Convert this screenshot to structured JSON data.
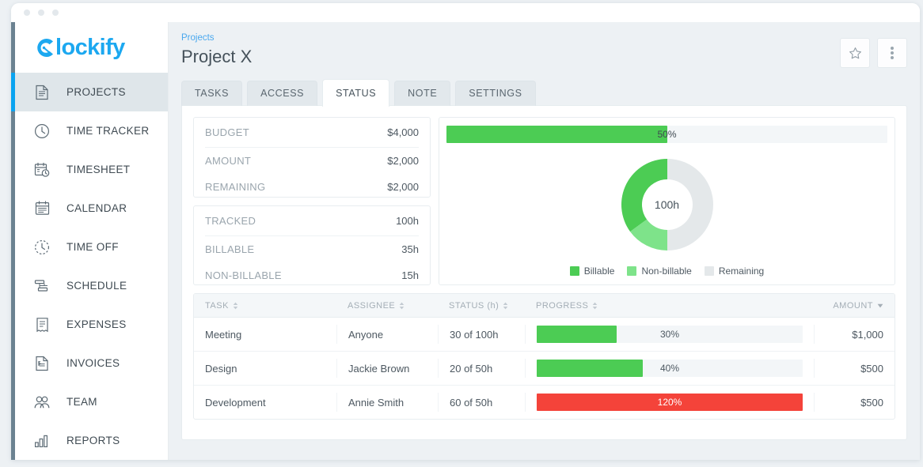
{
  "window": {
    "dots": [
      "dot-1",
      "dot-2",
      "dot-3"
    ]
  },
  "sidebar": {
    "logo": "lockify",
    "logo_full": "Clockify",
    "items": [
      {
        "label": "PROJECTS",
        "icon": "document-icon",
        "active": true
      },
      {
        "label": "TIME TRACKER",
        "icon": "clock-icon",
        "active": false
      },
      {
        "label": "TIMESHEET",
        "icon": "calendar-clock-icon",
        "active": false
      },
      {
        "label": "CALENDAR",
        "icon": "calendar-icon",
        "active": false
      },
      {
        "label": "TIME OFF",
        "icon": "clock-dashed-icon",
        "active": false
      },
      {
        "label": "SCHEDULE",
        "icon": "gantt-icon",
        "active": false
      },
      {
        "label": "EXPENSES",
        "icon": "receipt-icon",
        "active": false
      },
      {
        "label": "INVOICES",
        "icon": "invoice-icon",
        "active": false
      },
      {
        "label": "TEAM",
        "icon": "people-icon",
        "active": false
      },
      {
        "label": "REPORTS",
        "icon": "bar-chart-icon",
        "active": false
      }
    ]
  },
  "header": {
    "breadcrumb": "Projects",
    "title": "Project X",
    "favorite_icon": "star-icon",
    "more_icon": "more-vertical-icon"
  },
  "tabs": [
    {
      "label": "TASKS",
      "active": false
    },
    {
      "label": "ACCESS",
      "active": false
    },
    {
      "label": "STATUS",
      "active": true
    },
    {
      "label": "NOTE",
      "active": false
    },
    {
      "label": "SETTINGS",
      "active": false
    }
  ],
  "budget_box": {
    "primary": {
      "label": "BUDGET",
      "value": "$4,000"
    },
    "rows": [
      {
        "label": "AMOUNT",
        "value": "$2,000"
      },
      {
        "label": "REMAINING",
        "value": "$2,000"
      }
    ]
  },
  "time_box": {
    "primary": {
      "label": "TRACKED",
      "value": "100h"
    },
    "rows": [
      {
        "label": "BILLABLE",
        "value": "35h"
      },
      {
        "label": "NON-BILLABLE",
        "value": "15h"
      }
    ]
  },
  "overall_progress": {
    "label": "50%",
    "percent": 50
  },
  "colors": {
    "green": "#4ccc54",
    "light_green": "#7ee38a",
    "grey": "#e4e8ea",
    "red": "#f4433a",
    "track": "#f3f6f8",
    "accent_blue": "#1ca8f0"
  },
  "chart_data": {
    "type": "pie",
    "title": "",
    "center_label": "100h",
    "legend_position": "bottom",
    "labels": [
      "Billable",
      "Non-billable",
      "Remaining"
    ],
    "values": [
      35,
      15,
      50
    ],
    "units": "h",
    "colors": [
      "#4ccc54",
      "#7ee38a",
      "#e4e8ea"
    ],
    "total": 100,
    "direction": "counter-clockwise",
    "start_angle": 0
  },
  "table": {
    "columns": [
      {
        "label": "TASK",
        "sort": "both"
      },
      {
        "label": "ASSIGNEE",
        "sort": "both"
      },
      {
        "label": "STATUS (h)",
        "sort": "both"
      },
      {
        "label": "PROGRESS",
        "sort": "both"
      },
      {
        "label": "AMOUNT",
        "sort": "desc"
      }
    ],
    "rows": [
      {
        "task": "Meeting",
        "assignee": "Anyone",
        "status": "30 of 100h",
        "progress_label": "30%",
        "progress_percent": 30,
        "over_budget": false,
        "amount": "$1,000"
      },
      {
        "task": "Design",
        "assignee": "Jackie Brown",
        "status": "20 of 50h",
        "progress_label": "40%",
        "progress_percent": 40,
        "over_budget": false,
        "amount": "$500"
      },
      {
        "task": "Development",
        "assignee": "Annie Smith",
        "status": "60 of 50h",
        "progress_label": "120%",
        "progress_percent": 100,
        "over_budget": true,
        "amount": "$500"
      }
    ]
  }
}
